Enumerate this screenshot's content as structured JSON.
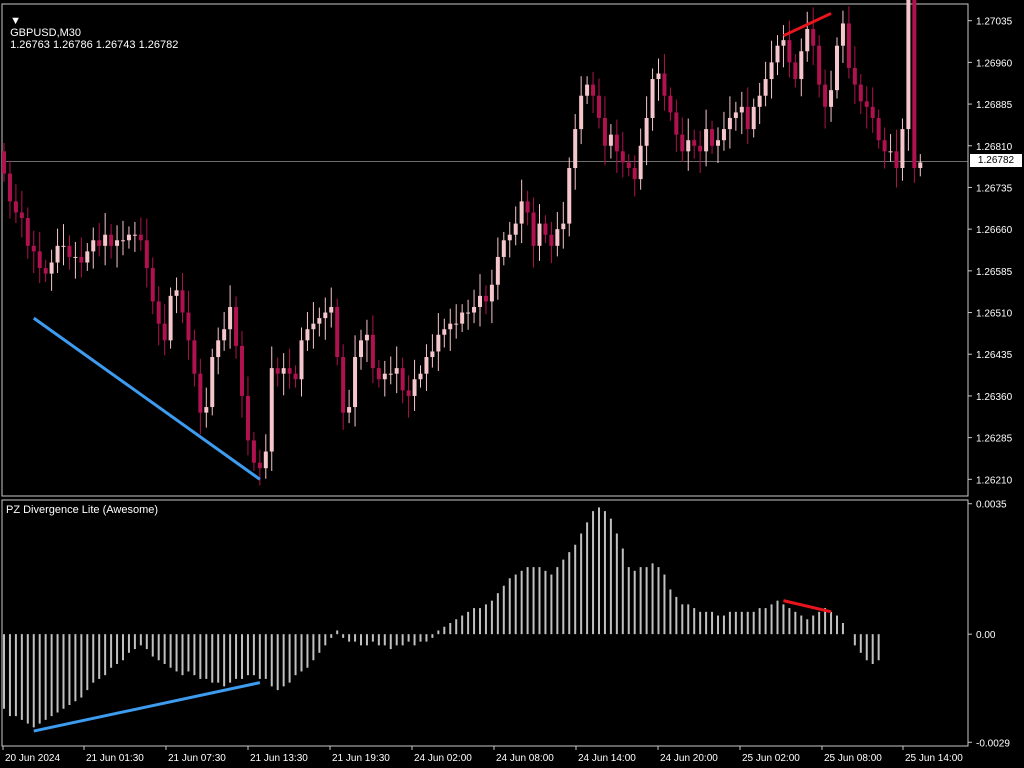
{
  "header": {
    "symbol_label": "GBPUSD,M30",
    "ohlc": "1.26763 1.26786 1.26743 1.26782",
    "current_price": "1.26782"
  },
  "indicator": {
    "title": "PZ Divergence Lite (Awesome)"
  },
  "colors": {
    "background": "#000000",
    "bull_candle": "#f5c6cb",
    "bear_candle": "#b0124f",
    "oscillator_bar": "#c0c0c0",
    "bullish_divergence": "#3d9bf0",
    "bearish_divergence": "#e8141e",
    "frame": "#c8c8c8",
    "price_line": "#b0b0b0"
  },
  "chart_data": [
    {
      "type": "candlestick",
      "y_ticks": [
        "1.27035",
        "1.26960",
        "1.26885",
        "1.26810",
        "1.26735",
        "1.26660",
        "1.26585",
        "1.26510",
        "1.26435",
        "1.26360",
        "1.26285",
        "1.26210"
      ],
      "ylim": [
        1.2618,
        1.27065
      ],
      "current_price": 1.26782,
      "closes": [
        1.2676,
        1.2671,
        1.2669,
        1.2668,
        1.2663,
        1.2662,
        1.2659,
        1.2658,
        1.266,
        1.2663,
        1.2663,
        1.2661,
        1.2661,
        1.266,
        1.2662,
        1.2664,
        1.2663,
        1.2665,
        1.2663,
        1.2664,
        1.2664,
        1.2665,
        1.2665,
        1.2664,
        1.2659,
        1.2653,
        1.2649,
        1.2646,
        1.2654,
        1.2655,
        1.2651,
        1.2646,
        1.264,
        1.2633,
        1.2634,
        1.2643,
        1.2646,
        1.2648,
        1.2652,
        1.2645,
        1.2636,
        1.2628,
        1.2624,
        1.2623,
        1.2626,
        1.2641,
        1.264,
        1.2641,
        1.264,
        1.2639,
        1.2646,
        1.2648,
        1.2649,
        1.265,
        1.2651,
        1.2652,
        1.2643,
        1.2633,
        1.2634,
        1.2643,
        1.2646,
        1.2647,
        1.2641,
        1.2639,
        1.264,
        1.264,
        1.2641,
        1.2637,
        1.2636,
        1.2639,
        1.264,
        1.2643,
        1.2644,
        1.2647,
        1.2648,
        1.2649,
        1.2649,
        1.2651,
        1.2651,
        1.2652,
        1.2654,
        1.2653,
        1.2656,
        1.2661,
        1.2664,
        1.2665,
        1.2667,
        1.2671,
        1.2669,
        1.2663,
        1.2667,
        1.2665,
        1.2663,
        1.2666,
        1.2667,
        1.2677,
        1.2684,
        1.269,
        1.2692,
        1.269,
        1.2686,
        1.2681,
        1.2683,
        1.268,
        1.2678,
        1.2677,
        1.2675,
        1.2681,
        1.2686,
        1.2693,
        1.2694,
        1.269,
        1.2687,
        1.2683,
        1.268,
        1.2682,
        1.2681,
        1.268,
        1.2684,
        1.2681,
        1.2682,
        1.2684,
        1.2686,
        1.2687,
        1.2688,
        1.2684,
        1.2688,
        1.269,
        1.2693,
        1.2696,
        1.2699,
        1.27,
        1.2696,
        1.2693,
        1.2698,
        1.2702,
        1.2699,
        1.2692,
        1.2688,
        1.2691,
        1.2699,
        1.2703,
        1.2695,
        1.2692,
        1.2689,
        1.2688,
        1.2686,
        1.2682,
        1.268,
        1.268,
        1.2677,
        1.2684,
        1.2778,
        1.2677,
        1.2678
      ],
      "bullish_divergence": {
        "from": 5,
        "to": 43
      },
      "bearish_divergence": {
        "from": 131,
        "to": 139
      }
    },
    {
      "type": "bar",
      "y_ticks": [
        "0.0035",
        "0.00",
        "-0.0029"
      ],
      "ylim": [
        -0.003,
        0.0036
      ],
      "values": [
        -0.002,
        -0.0022,
        -0.0022,
        -0.0023,
        -0.0024,
        -0.0025,
        -0.0024,
        -0.0023,
        -0.0022,
        -0.0021,
        -0.002,
        -0.0019,
        -0.0018,
        -0.0017,
        -0.0015,
        -0.0013,
        -0.0012,
        -0.0011,
        -0.0009,
        -0.0008,
        -0.0007,
        -0.0005,
        -0.0004,
        -0.0003,
        -0.0004,
        -0.0006,
        -0.0007,
        -0.0008,
        -0.0009,
        -0.001,
        -0.0011,
        -0.001,
        -0.0011,
        -0.0012,
        -0.0012,
        -0.0013,
        -0.0013,
        -0.0014,
        -0.0013,
        -0.0012,
        -0.0012,
        -0.0011,
        -0.0011,
        -0.0012,
        -0.0012,
        -0.0014,
        -0.0015,
        -0.0014,
        -0.0013,
        -0.0011,
        -0.001,
        -0.0009,
        -0.0007,
        -0.0005,
        -0.0003,
        -0.0001,
        0.0001,
        -0.0001,
        -0.0002,
        -0.0002,
        -0.0003,
        -0.0003,
        -0.0002,
        -0.0003,
        -0.0003,
        -0.0004,
        -0.0003,
        -0.0003,
        -0.0002,
        -0.0003,
        -0.0002,
        -0.0002,
        -0.0001,
        0.0001,
        0.0002,
        0.0003,
        0.0004,
        0.0005,
        0.0006,
        0.0007,
        0.0007,
        0.0008,
        0.0009,
        0.0011,
        0.0013,
        0.0015,
        0.0016,
        0.0017,
        0.0018,
        0.0018,
        0.0018,
        0.0017,
        0.0016,
        0.0018,
        0.002,
        0.0022,
        0.0024,
        0.0027,
        0.003,
        0.0033,
        0.0034,
        0.0033,
        0.0031,
        0.0027,
        0.0023,
        0.0018,
        0.0017,
        0.0018,
        0.0018,
        0.0019,
        0.0018,
        0.0016,
        0.0012,
        0.001,
        0.0008,
        0.0008,
        0.0007,
        0.0006,
        0.0006,
        0.0006,
        0.0005,
        0.0005,
        0.0006,
        0.0006,
        0.0006,
        0.0006,
        0.0006,
        0.0007,
        0.0007,
        0.0008,
        0.0009,
        0.0008,
        0.0007,
        0.0006,
        0.0005,
        0.0004,
        0.0005,
        0.0006,
        0.0007,
        0.0006,
        0.0005,
        0.0003,
        0.0,
        -0.0003,
        -0.0005,
        -0.0007,
        -0.0008,
        -0.0007
      ],
      "bullish_divergence": {
        "from": 5,
        "to": 43,
        "values": [
          -0.0026,
          -0.0013
        ]
      },
      "bearish_divergence": {
        "from": 131,
        "to": 139,
        "values": [
          0.0009,
          0.0006
        ]
      }
    }
  ],
  "x_ticks": [
    "20 Jun 2024",
    "21 Jun 01:30",
    "21 Jun 07:30",
    "21 Jun 13:30",
    "21 Jun 19:30",
    "24 Jun 02:00",
    "24 Jun 08:00",
    "24 Jun 14:00",
    "24 Jun 20:00",
    "25 Jun 02:00",
    "25 Jun 08:00",
    "25 Jun 14:00"
  ]
}
